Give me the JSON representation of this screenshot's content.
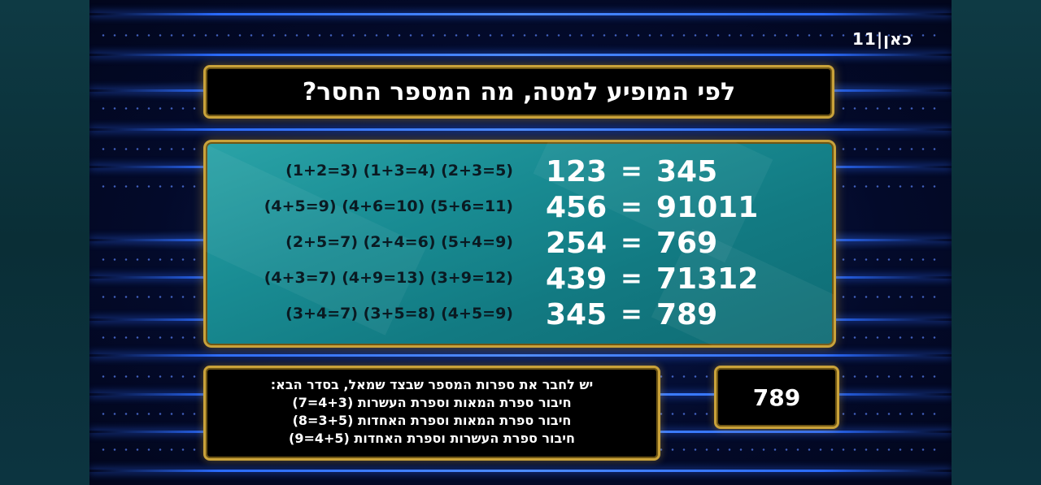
{
  "logo": {
    "text": "כאן|11"
  },
  "question": {
    "text": "לפי המופיע למטה, מה המספר החסר?"
  },
  "puzzle": {
    "rows": [
      {
        "hint": "(1+2=3) (1+3=4) (2+3=5)",
        "left": "123",
        "equals": "=",
        "right": "345"
      },
      {
        "hint": "(4+5=9) (4+6=10) (5+6=11)",
        "left": "456",
        "equals": "=",
        "right": "91011"
      },
      {
        "hint": "(2+5=7) (2+4=6) (5+4=9)",
        "left": "254",
        "equals": "=",
        "right": "769"
      },
      {
        "hint": "(4+3=7) (4+9=13) (3+9=12)",
        "left": "439",
        "equals": "=",
        "right": "71312"
      },
      {
        "hint": "(3+4=7) (3+5=8) (4+5=9)",
        "left": "345",
        "equals": "=",
        "right": "789"
      }
    ]
  },
  "explanation": {
    "lines": [
      "יש לחבר את ספרות המספר שבצד שמאל, בסדר הבא:",
      "חיבור ספרת המאות וספרת העשרות (4+3=7)",
      "חיבור ספרת המאות וספרת האחדות (3+5=8)",
      "חיבור ספרת העשרות וספרת האחדות (4+5=9)"
    ]
  },
  "answer": {
    "text": "789"
  },
  "colors": {
    "border_gold": "#c9a23a",
    "panel_teal": "#198c93",
    "background_blue": "#0a1e5a",
    "line_blue": "#2a6bff"
  }
}
